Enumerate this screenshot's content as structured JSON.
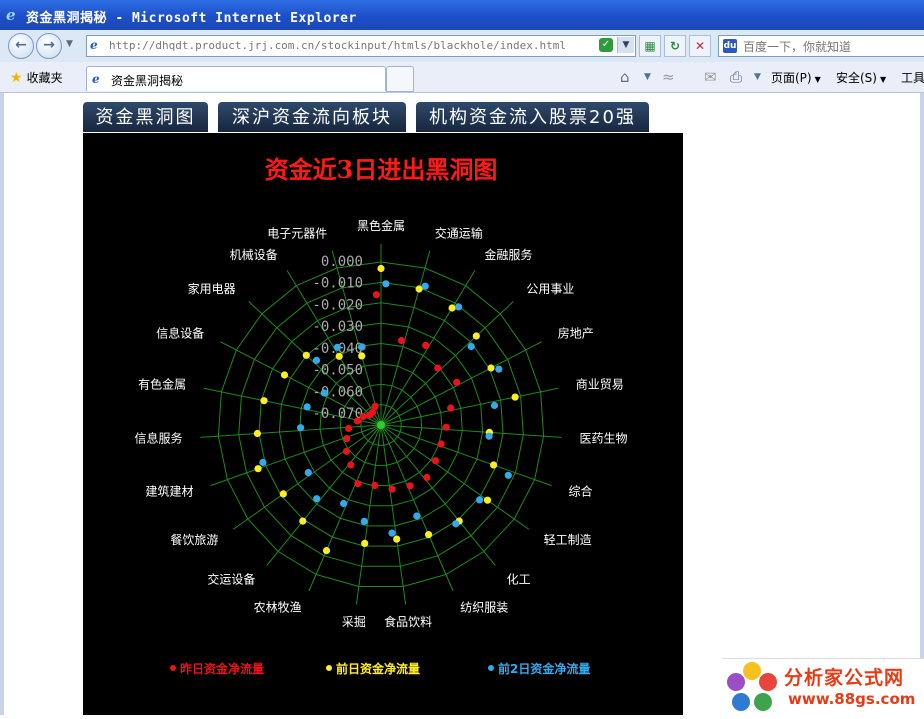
{
  "window": {
    "title": "资金黑洞揭秘 - Microsoft Internet Explorer"
  },
  "toolbar": {
    "url": "http://dhqdt.product.jrj.com.cn/stockinput/htmls/blackhole/index.html",
    "search_placeholder": "百度一下，你就知道",
    "favorites_label": "收藏夹",
    "tab_title": "资金黑洞揭秘",
    "menu_page": "页面(P)",
    "menu_safety": "安全(S)",
    "menu_tools": "工具"
  },
  "tabs": [
    "资金黑洞图",
    "深沪资金流向板块",
    "机构资金流入股票20强"
  ],
  "chart_data": {
    "type": "radar",
    "title": "资金近3日进出黑洞图",
    "categories": [
      "黑色金属",
      "交通运输",
      "金融服务",
      "公用事业",
      "房地产",
      "商业贸易",
      "医药生物",
      "综合",
      "轻工制造",
      "化工",
      "纺织服装",
      "食品饮料",
      "采掘",
      "农林牧渔",
      "交运设备",
      "餐饮旅游",
      "建筑建材",
      "信息服务",
      "有色金属",
      "信息设备",
      "家用电器",
      "机械设备",
      "电子元器件"
    ],
    "axis_ticks": [
      "0.000",
      "-0.010",
      "-0.020",
      "-0.030",
      "-0.040",
      "-0.050",
      "-0.060",
      "-0.070"
    ],
    "rmax": 0.0,
    "rmin": -0.075,
    "legend": "bottom",
    "grid": true,
    "series": [
      {
        "name": "昨日资金净流量",
        "color": "#e8141a",
        "values": [
          -0.015,
          -0.035,
          -0.033,
          -0.038,
          -0.035,
          -0.042,
          -0.045,
          -0.046,
          -0.045,
          -0.043,
          -0.044,
          -0.045,
          -0.047,
          -0.046,
          -0.052,
          -0.055,
          -0.058,
          -0.06,
          -0.064,
          -0.066,
          -0.068,
          -0.068,
          -0.066
        ]
      },
      {
        "name": "前日资金净流量",
        "color": "#ffee22",
        "values": [
          -0.003,
          -0.01,
          -0.012,
          -0.015,
          -0.018,
          -0.012,
          -0.025,
          -0.02,
          -0.015,
          -0.018,
          -0.02,
          -0.022,
          -0.02,
          -0.012,
          -0.018,
          -0.02,
          -0.015,
          -0.018,
          -0.02,
          -0.025,
          -0.028,
          -0.038,
          -0.042
        ]
      },
      {
        "name": "前2日资金净流量",
        "color": "#33aaee",
        "values": [
          -0.01,
          -0.008,
          -0.01,
          -0.02,
          -0.015,
          -0.022,
          -0.025,
          -0.012,
          -0.018,
          -0.018,
          -0.03,
          -0.025,
          -0.03,
          -0.035,
          -0.03,
          -0.035,
          -0.018,
          -0.038,
          -0.04,
          -0.045,
          -0.033,
          -0.034,
          -0.038
        ]
      }
    ]
  },
  "watermark": {
    "brand": "分析家公式网",
    "site": "www.88gs.com"
  }
}
